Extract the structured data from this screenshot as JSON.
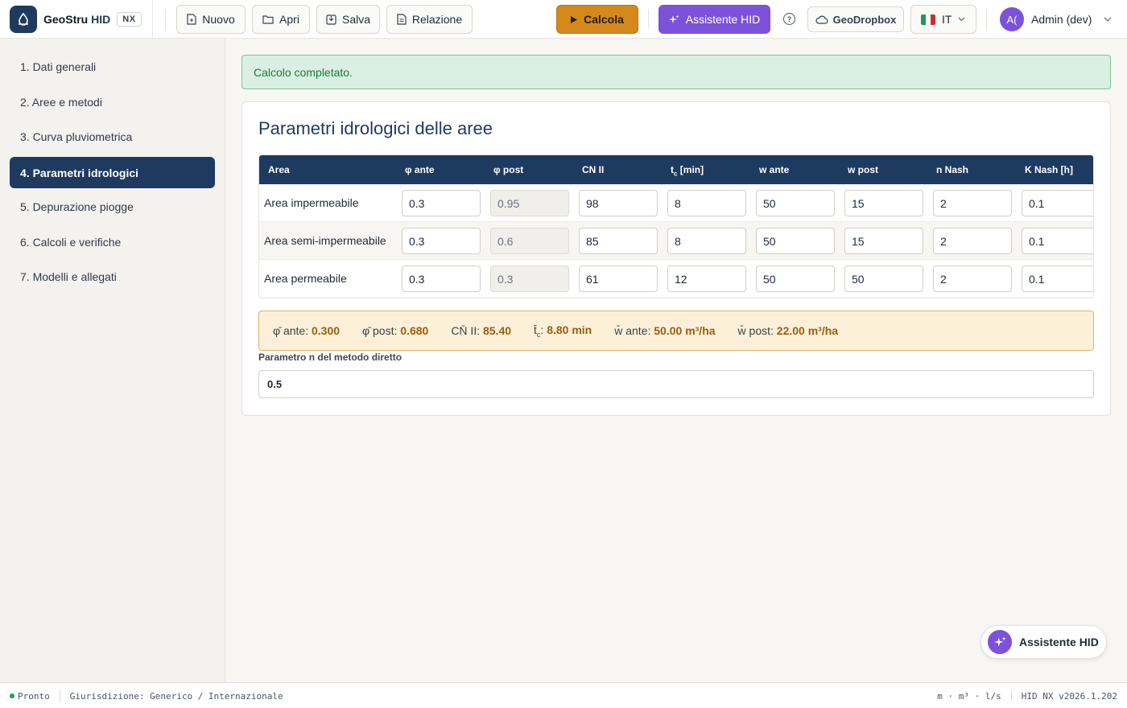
{
  "brand": {
    "name": "GeoStru",
    "accent": "HID",
    "badge": "NX",
    "logo_icon": "drop-icon"
  },
  "toolbar": {
    "new_label": "Nuovo",
    "open_label": "Apri",
    "save_label": "Salva",
    "report_label": "Relazione",
    "calc_label": "Calcola",
    "assistant_label": "Assistente HID",
    "help_label": "?",
    "dropbox_label": "GeoDropbox",
    "language_label": "IT",
    "user_initials": "A(",
    "user_name": "Admin (dev)"
  },
  "sidebar": {
    "items": [
      {
        "label": "1. Dati generali"
      },
      {
        "label": "2. Aree e metodi"
      },
      {
        "label": "3. Curva pluviometrica"
      },
      {
        "label": "4. Parametri idrologici",
        "active": true
      },
      {
        "label": "5. Depurazione piogge"
      },
      {
        "label": "6. Calcoli e verifiche"
      },
      {
        "label": "7. Modelli e allegati"
      }
    ]
  },
  "alert": {
    "text": "Calcolo completato."
  },
  "card": {
    "title": "Parametri idrologici delle aree",
    "columns": [
      "Area",
      "φ ante",
      "φ post",
      "CN II",
      "t",
      "c",
      " [min]",
      "w ante",
      "w post",
      "n Nash",
      "K Nash [h]"
    ],
    "rows": [
      {
        "area": "Area impermeabile",
        "phi_ante": "0.3",
        "phi_post": "0.95",
        "cn2": "98",
        "tc": "8",
        "w_ante": "50",
        "w_post": "15",
        "n_nash": "2",
        "k_nash": "0.1"
      },
      {
        "area": "Area semi-impermeabile",
        "phi_ante": "0.3",
        "phi_post": "0.6",
        "cn2": "85",
        "tc": "8",
        "w_ante": "50",
        "w_post": "15",
        "n_nash": "2",
        "k_nash": "0.1"
      },
      {
        "area": "Area permeabile",
        "phi_ante": "0.3",
        "phi_post": "0.3",
        "cn2": "61",
        "tc": "12",
        "w_ante": "50",
        "w_post": "50",
        "n_nash": "2",
        "k_nash": "0.1"
      }
    ],
    "summary": {
      "phi_ante_label": "φ̄ ante:",
      "phi_ante_value": "0.300",
      "phi_post_label": "φ̄ post:",
      "phi_post_value": "0.680",
      "cn_label": "CN̄ II:",
      "cn_value": "85.40",
      "tc_label": "t̄",
      "tc_sub": "c",
      "tc_colon": ":",
      "tc_value": "8.80 min",
      "w_ante_label": "w̄ ante:",
      "w_ante_value": "50.00 m³/ha",
      "w_post_label": "w̄ post:",
      "w_post_value": "22.00 m³/ha"
    },
    "param": {
      "label": "Parametro n del metodo diretto",
      "value": "0.5"
    }
  },
  "fab": {
    "label": "Assistente HID"
  },
  "statusbar": {
    "status": "Pronto",
    "jurisdiction": "Giurisdizione: Generico / Internazionale",
    "units": "m · m³ · l/s",
    "version": "HID NX v2026.1.202"
  },
  "colors": {
    "primary": "#1e3a5f",
    "calc": "#d4891a",
    "assistant": "#7b52d9",
    "success_bg": "#d9efe1",
    "summary_bg": "#fcf0d9"
  }
}
